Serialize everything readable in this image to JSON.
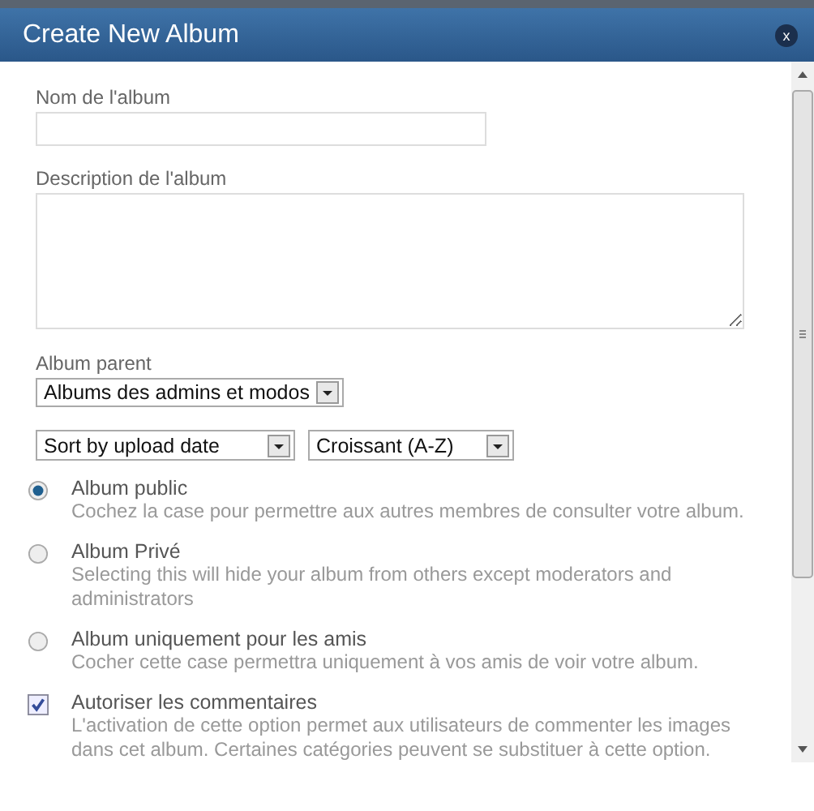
{
  "dialog": {
    "title": "Create New Album",
    "close": "x"
  },
  "fields": {
    "name_label": "Nom de l'album",
    "description_label": "Description de l'album",
    "parent_label": "Album parent",
    "parent_value": "Albums des admins et modos",
    "sort_value": "Sort by upload date",
    "order_value": "Croissant (A-Z)"
  },
  "options": [
    {
      "kind": "radio",
      "selected": true,
      "label": "Album public",
      "description": "Cochez la case pour permettre aux autres membres de consulter votre album."
    },
    {
      "kind": "radio",
      "selected": false,
      "label": "Album Privé",
      "description": "Selecting this will hide your album from others except moderators and administrators"
    },
    {
      "kind": "radio",
      "selected": false,
      "label": "Album uniquement pour les amis",
      "description": "Cocher cette case permettra uniquement à vos amis de voir votre album."
    },
    {
      "kind": "checkbox",
      "checked": true,
      "label": "Autoriser les commentaires",
      "description": "L'activation de cette option permet aux utilisateurs de commenter les images dans cet album. Certaines catégories peuvent se substituer à cette option."
    }
  ]
}
